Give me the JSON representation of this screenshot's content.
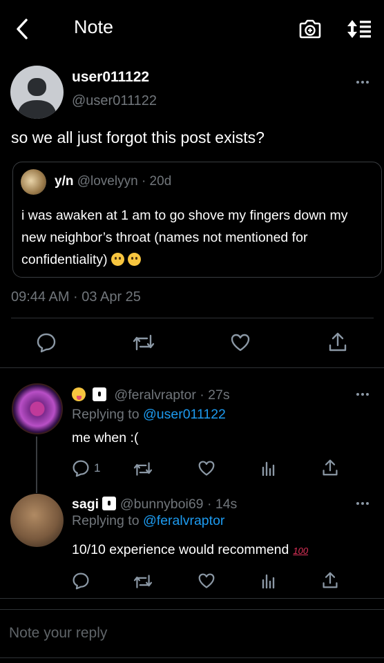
{
  "header": {
    "title": "Note",
    "back_icon": "chevron-left-icon",
    "camera_icon": "camera-plus-icon",
    "sort_icon": "sort-list-icon"
  },
  "post": {
    "author_name": "user011122",
    "author_handle": "@user011122",
    "text": "so we all just forgot this post exists?",
    "quote": {
      "name": "y/n",
      "handle": "@lovelyyn",
      "age": "· 20d",
      "text": "i was awaken at 1 am to go shove my fingers down my new neighbor’s throat (names not mentioned for confidentiality)"
    },
    "timestamp": "09:44 AM · 03 Apr 25"
  },
  "replies": [
    {
      "handle": "@feralvraptor",
      "age": "· 27s",
      "replying_prefix": "Replying to",
      "replying_to": "@user011122",
      "text": "me when :(",
      "reply_count": "1"
    },
    {
      "name": "sagi",
      "handle": "@bunnyboi69",
      "age": "· 14s",
      "replying_prefix": "Replying to",
      "replying_to": "@feralvraptor",
      "text": "10/10 experience would recommend",
      "emoji_text": "100"
    }
  ],
  "composer": {
    "placeholder": "Note your reply"
  },
  "colors": {
    "background": "#000000",
    "accent": "#1d9bf0",
    "muted": "#71767b",
    "divider": "#2f3336"
  }
}
